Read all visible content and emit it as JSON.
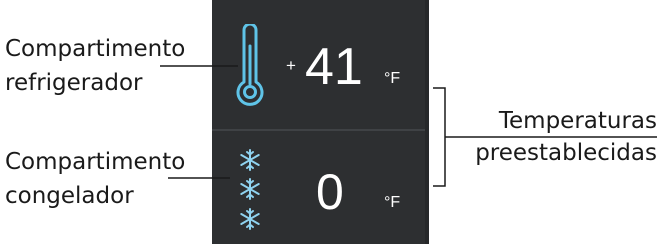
{
  "labels": {
    "fridge_line1": "Compartimento",
    "fridge_line2": "refrigerador",
    "freezer_line1": "Compartimento",
    "freezer_line2": "congelador",
    "preset_line1": "Temperaturas",
    "preset_line2": "preestablecidas"
  },
  "fridge": {
    "sign": "+",
    "value": "41",
    "unit": "°F",
    "icon": "thermometer-icon"
  },
  "freezer": {
    "value": "0",
    "unit": "°F",
    "icon": "snowflake-icon",
    "icon_count": 3
  },
  "colors": {
    "panel": "#2d2f31",
    "thermometer": "#5fc4e8",
    "snowflake": "#8fd3f0",
    "text_dark": "#1a1a1a",
    "text_light": "#ffffff"
  }
}
